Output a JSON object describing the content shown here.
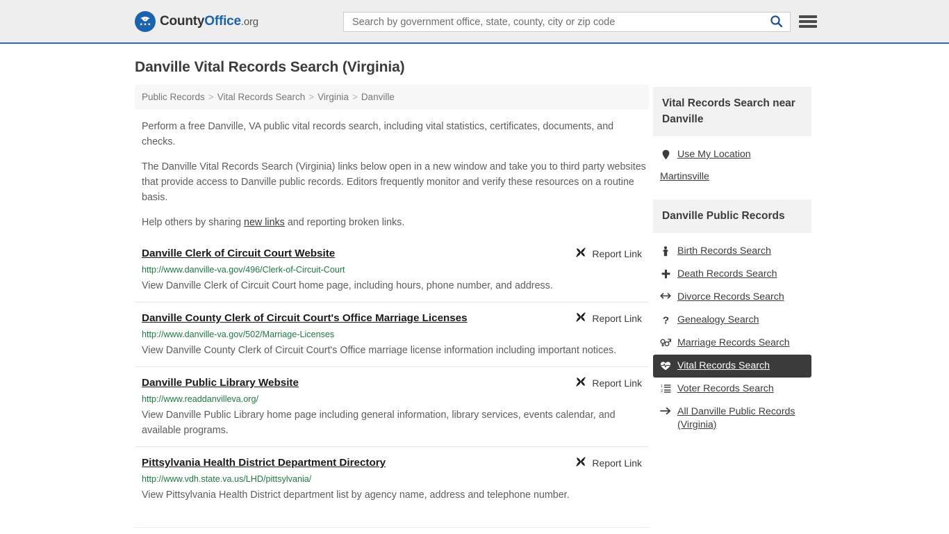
{
  "header": {
    "logo": {
      "part1": "County",
      "part2": "Office",
      "suffix": ".org",
      "icon": "eagle-shield-icon"
    },
    "search": {
      "placeholder": "Search by government office, state, county, city or zip code",
      "value": "",
      "search_icon": "search-icon"
    },
    "menu_icon": "hamburger-menu-icon",
    "accent_color": "#2b6cb0",
    "background_color": "#eeeeee"
  },
  "main": {
    "title": "Danville Vital Records Search (Virginia)",
    "breadcrumb": [
      "Public Records",
      "Vital Records Search",
      "Virginia",
      "Danville"
    ],
    "breadcrumb_separator": ">",
    "paragraphs": {
      "p1": "Perform a free Danville, VA public vital records search, including vital statistics, certificates, documents, and checks.",
      "p2": "The Danville Vital Records Search (Virginia) links below open in a new window and take you to third party websites that provide access to Danville public records. Editors frequently monitor and verify these resources on a routine basis.",
      "p3_before": "Help others by sharing ",
      "p3_link": "new links",
      "p3_after": " and reporting broken links."
    },
    "report_link_label": "Report Link",
    "report_link_icon": "broken-link-icon",
    "results": [
      {
        "title": "Danville Clerk of Circuit Court Website",
        "url": "http://www.danville-va.gov/496/Clerk-of-Circuit-Court",
        "description": "View Danville Clerk of Circuit Court home page, including hours, phone number, and address."
      },
      {
        "title": "Danville County Clerk of Circuit Court's Office Marriage Licenses",
        "url": "http://www.danville-va.gov/502/Marriage-Licenses",
        "description": "View Danville County Clerk of Circuit Court's Office marriage license information including important notices."
      },
      {
        "title": "Danville Public Library Website",
        "url": "http://www.readdanvilleva.org/",
        "description": "View Danville Public Library home page including general information, library services, events calendar, and available programs."
      },
      {
        "title": "Pittsylvania Health District Department Directory",
        "url": "http://www.vdh.state.va.us/LHD/pittsylvania/",
        "description": "View Pittsylvania Health District department list by agency name, address and telephone number."
      }
    ]
  },
  "sidebar": {
    "near_panel": {
      "heading": "Vital Records Search near Danville",
      "use_my_location": {
        "label": "Use My Location",
        "icon": "map-pin-icon"
      },
      "places": [
        "Martinsville"
      ]
    },
    "records_panel": {
      "heading": "Danville Public Records",
      "items": [
        {
          "label": "Birth Records Search",
          "icon": "baby-icon",
          "active": false
        },
        {
          "label": "Death Records Search",
          "icon": "cross-icon",
          "active": false
        },
        {
          "label": "Divorce Records Search",
          "icon": "arrows-left-right-icon",
          "active": false
        },
        {
          "label": "Genealogy Search",
          "icon": "question-mark-icon",
          "active": false
        },
        {
          "label": "Marriage Records Search",
          "icon": "venus-mars-icon",
          "active": false
        },
        {
          "label": "Vital Records Search",
          "icon": "heartbeat-icon",
          "active": true
        },
        {
          "label": "Voter Records Search",
          "icon": "ordered-list-icon",
          "active": false
        },
        {
          "label": "All Danville Public Records (Virginia)",
          "icon": "arrow-right-icon",
          "active": false
        }
      ],
      "active_background": "#3b3b3b"
    }
  }
}
